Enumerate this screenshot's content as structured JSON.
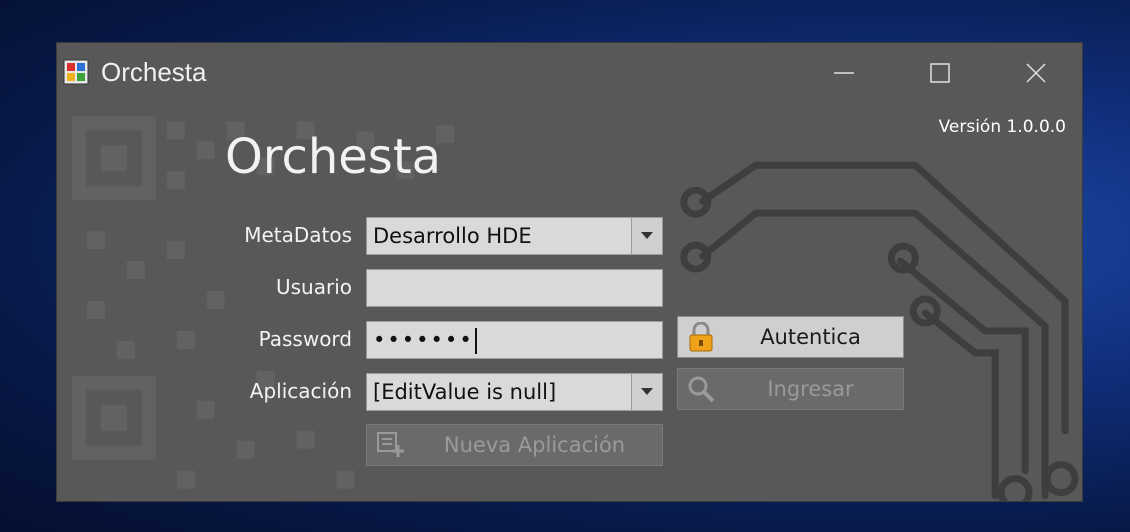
{
  "window": {
    "title": "Orchesta",
    "app_icon": "app-grid-icon",
    "controls": {
      "minimize": "minimize-icon",
      "maximize": "maximize-icon",
      "close": "close-icon"
    }
  },
  "version": "Versión 1.0.0.0",
  "heading": "Orchesta",
  "form": {
    "metadatos": {
      "label": "MetaDatos",
      "value": "Desarrollo HDE"
    },
    "usuario": {
      "label": "Usuario",
      "value": ""
    },
    "password": {
      "label": "Password",
      "value": "•••••••"
    },
    "aplicacion": {
      "label": "Aplicación",
      "value": "[EditValue is null]"
    }
  },
  "buttons": {
    "autentica": {
      "label": "Autentica",
      "icon": "lock-icon"
    },
    "ingresar": {
      "label": "Ingresar",
      "icon": "magnifier-icon"
    },
    "nueva": {
      "label": "Nueva Aplicación",
      "icon": "add-app-icon"
    }
  },
  "colors": {
    "window_bg": "#585858",
    "desktop": "#0f2d78",
    "field_bg": "#d9d9d9"
  }
}
